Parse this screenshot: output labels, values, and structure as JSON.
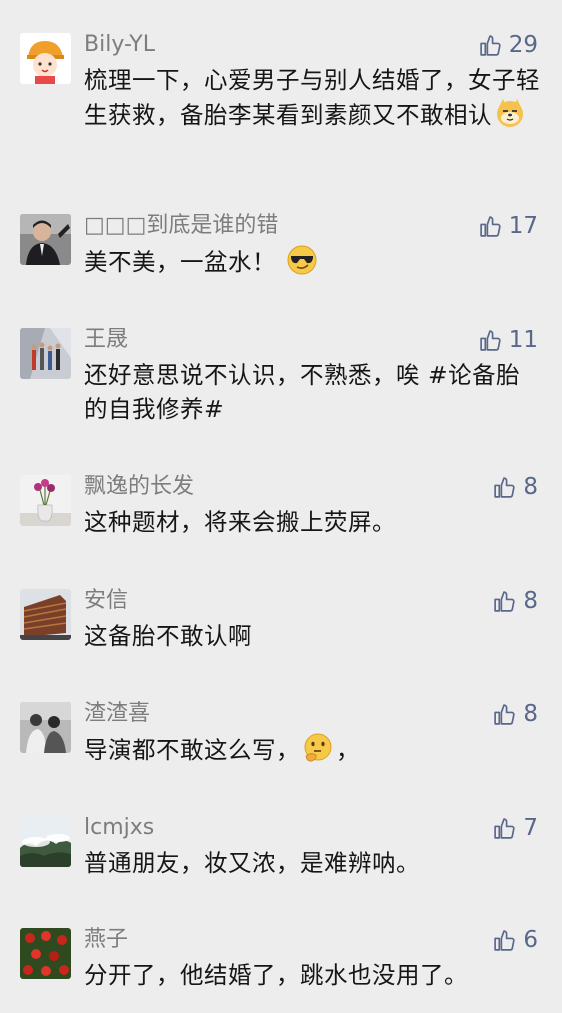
{
  "comments": [
    {
      "name": "Bily-YL",
      "likes": "29",
      "text": "梳理一下，心爱男子与别人结婚了，女子轻生获救，备胎李某看到素颜又不敢相认",
      "emoji": "doge-emoji",
      "avatar": "cartoon-girl-avatar"
    },
    {
      "name": "□□□到底是谁的错",
      "likes": "17",
      "text": "美不美，一盆水！",
      "emoji": "sunglasses-emoji",
      "avatar": "man-in-suit-avatar"
    },
    {
      "name": "王晟",
      "likes": "11",
      "text": "还好意思说不认识，不熟悉，唉 #论备胎的自我修养#",
      "emoji": "",
      "avatar": "group-photo-avatar"
    },
    {
      "name": "飘逸的长发",
      "likes": "8",
      "text": "这种题材，将来会搬上荧屏。",
      "emoji": "",
      "avatar": "flower-vase-avatar"
    },
    {
      "name": "安信",
      "likes": "8",
      "text": "这备胎不敢认啊",
      "emoji": "",
      "avatar": "building-avatar"
    },
    {
      "name": "渣渣喜",
      "likes": "8",
      "text": "导演都不敢这么写，",
      "emoji": "thinking-emoji",
      "text_after": "，",
      "avatar": "vintage-couple-avatar"
    },
    {
      "name": "lcmjxs",
      "likes": "7",
      "text": "普通朋友，妆又浓，是难辨呐。",
      "emoji": "",
      "avatar": "mountain-clouds-avatar"
    },
    {
      "name": "燕子",
      "likes": "6",
      "text": "分开了，他结婚了，跳水也没用了。",
      "emoji": "",
      "avatar": "red-flowers-avatar"
    }
  ],
  "colors": {
    "like": "#58678a",
    "name": "#7d7d7d",
    "text": "#161616",
    "background": "#ededed"
  }
}
